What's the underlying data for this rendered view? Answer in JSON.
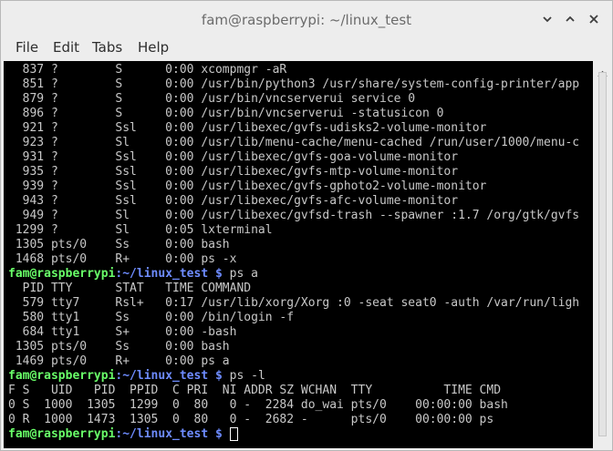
{
  "window": {
    "title": "fam@raspberrypi: ~/linux_test"
  },
  "menubar": {
    "items": [
      "File",
      "Edit",
      "Tabs",
      "Help"
    ]
  },
  "terminal": {
    "lines": [
      {
        "type": "output",
        "text": "  837 ?        S      0:00 xcompmgr -aR"
      },
      {
        "type": "output",
        "text": "  851 ?        S      0:00 /usr/bin/python3 /usr/share/system-config-printer/app"
      },
      {
        "type": "output",
        "text": "  879 ?        S      0:00 /usr/bin/vncserverui service 0"
      },
      {
        "type": "output",
        "text": "  896 ?        S      0:00 /usr/bin/vncserverui -statusicon 0"
      },
      {
        "type": "output",
        "text": "  921 ?        Ssl    0:00 /usr/libexec/gvfs-udisks2-volume-monitor"
      },
      {
        "type": "output",
        "text": "  923 ?        Sl     0:00 /usr/lib/menu-cache/menu-cached /run/user/1000/menu-c"
      },
      {
        "type": "output",
        "text": "  931 ?        Ssl    0:00 /usr/libexec/gvfs-goa-volume-monitor"
      },
      {
        "type": "output",
        "text": "  935 ?        Ssl    0:00 /usr/libexec/gvfs-mtp-volume-monitor"
      },
      {
        "type": "output",
        "text": "  939 ?        Ssl    0:00 /usr/libexec/gvfs-gphoto2-volume-monitor"
      },
      {
        "type": "output",
        "text": "  943 ?        Ssl    0:00 /usr/libexec/gvfs-afc-volume-monitor"
      },
      {
        "type": "output",
        "text": "  949 ?        Sl     0:00 /usr/libexec/gvfsd-trash --spawner :1.7 /org/gtk/gvfs"
      },
      {
        "type": "output",
        "text": " 1299 ?        Sl     0:05 lxterminal"
      },
      {
        "type": "output",
        "text": " 1305 pts/0    Ss     0:00 bash"
      },
      {
        "type": "output",
        "text": " 1468 pts/0    R+     0:00 ps -x"
      },
      {
        "type": "prompt",
        "user": "fam@raspberrypi",
        "sep": ":",
        "path": "~/linux_test",
        "sym": " $ ",
        "cmd": "ps a"
      },
      {
        "type": "output",
        "text": "  PID TTY      STAT   TIME COMMAND"
      },
      {
        "type": "output",
        "text": "  579 tty7     Rsl+   0:17 /usr/lib/xorg/Xorg :0 -seat seat0 -auth /var/run/ligh"
      },
      {
        "type": "output",
        "text": "  580 tty1     Ss     0:00 /bin/login -f"
      },
      {
        "type": "output",
        "text": "  684 tty1     S+     0:00 -bash"
      },
      {
        "type": "output",
        "text": " 1305 pts/0    Ss     0:00 bash"
      },
      {
        "type": "output",
        "text": " 1469 pts/0    R+     0:00 ps a"
      },
      {
        "type": "prompt",
        "user": "fam@raspberrypi",
        "sep": ":",
        "path": "~/linux_test",
        "sym": " $ ",
        "cmd": "ps -l"
      },
      {
        "type": "output",
        "text": "F S   UID   PID  PPID  C PRI  NI ADDR SZ WCHAN  TTY          TIME CMD"
      },
      {
        "type": "output",
        "text": "0 S  1000  1305  1299  0  80   0 -  2284 do_wai pts/0    00:00:00 bash"
      },
      {
        "type": "output",
        "text": "0 R  1000  1473  1305  0  80   0 -  2682 -      pts/0    00:00:00 ps"
      },
      {
        "type": "prompt",
        "user": "fam@raspberrypi",
        "sep": ":",
        "path": "~/linux_test",
        "sym": " $ ",
        "cmd": "",
        "cursor": true
      }
    ]
  },
  "icons": {
    "minimize": "minimize-icon",
    "maximize": "maximize-icon",
    "close": "close-icon",
    "scroll_up": "scroll-up-arrow-icon"
  },
  "colors": {
    "terminal_bg": "#000000",
    "terminal_fg": "#c8c8c8",
    "prompt_user": "#69ff69",
    "prompt_path": "#6e8cff"
  }
}
